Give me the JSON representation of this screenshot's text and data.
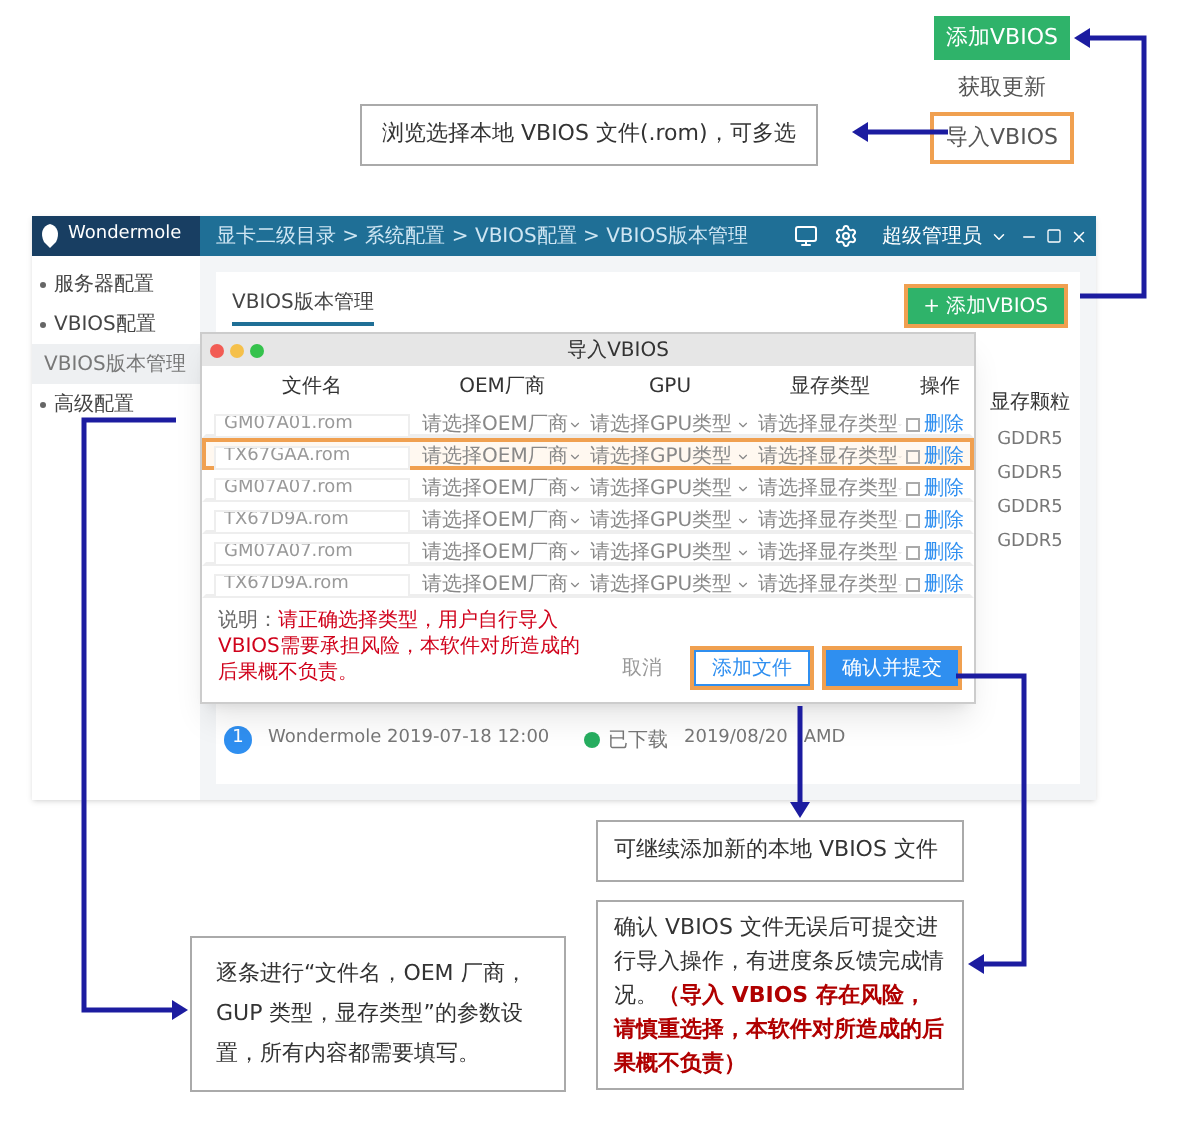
{
  "menu": {
    "items": [
      {
        "label": "添加VBIOS",
        "kind": "primary",
        "highlighted": false
      },
      {
        "label": "获取更新",
        "kind": "plain",
        "highlighted": false
      },
      {
        "label": "导入VBIOS",
        "kind": "plain",
        "highlighted": true
      }
    ]
  },
  "callouts": {
    "browse": "浏览选择本地 VBIOS 文件(.rom)，可多选",
    "add_more": "可继续添加新的本地 VBIOS 文件",
    "confirm": {
      "text": "确认 VBIOS 文件无误后可提交进行导入操作，有进度条反馈完成情况。",
      "warning": "（导入 VBIOS 存在风险，请慎重选择，本软件对所造成的后果概不负责）"
    },
    "fields": "逐条进行“文件名，OEM 厂商，GUP 类型，显存类型”的参数设置，所有内容都需要填写。"
  },
  "app": {
    "logo": "Wondermole",
    "breadcrumb": "显卡二级目录 > 系统配置 > VBIOS配置 > VBIOS版本管理",
    "user": "超级管理员",
    "sidebar": {
      "items": [
        {
          "label": "服务器配置",
          "selected": false
        },
        {
          "label": "VBIOS配置",
          "selected": false,
          "children": [
            {
              "label": "VBIOS版本管理",
              "selected": true
            }
          ]
        },
        {
          "label": "高级配置",
          "selected": false
        }
      ]
    },
    "tab": "VBIOS版本管理",
    "add_button": {
      "label": "+ 添加VBIOS",
      "highlighted": true
    },
    "side_column": {
      "header": "显存颗粒",
      "cells": [
        "GDDR5",
        "GDDR5",
        "GDDR5",
        "GDDR5"
      ]
    },
    "row": {
      "index": "1",
      "name": "Wondermole 2019-07-18 12:00",
      "status": "已下载",
      "date": "2019/08/20",
      "vendor": "AMD"
    }
  },
  "dialog": {
    "title": "导入VBIOS",
    "columns": [
      "文件名",
      "OEM厂商",
      "GPU",
      "显存类型",
      "操作"
    ],
    "rows": [
      {
        "file": "GM07A01.rom",
        "oem": "请选择OEM厂商",
        "gpu": "请选择GPU类型",
        "memory": "请选择显存类型",
        "action": "删除",
        "highlighted": false
      },
      {
        "file": "TX67GAA.rom",
        "oem": "请选择OEM厂商",
        "gpu": "请选择GPU类型",
        "memory": "请选择显存类型",
        "action": "删除",
        "highlighted": true
      },
      {
        "file": "GM07A07.rom",
        "oem": "请选择OEM厂商",
        "gpu": "请选择GPU类型",
        "memory": "请选择显存类型",
        "action": "删除",
        "highlighted": false
      },
      {
        "file": "TX67D9A.rom",
        "oem": "请选择OEM厂商",
        "gpu": "请选择GPU类型",
        "memory": "请选择显存类型",
        "action": "删除",
        "highlighted": false
      },
      {
        "file": "GM07A07.rom",
        "oem": "请选择OEM厂商",
        "gpu": "请选择GPU类型",
        "memory": "请选择显存类型",
        "action": "删除",
        "highlighted": false
      },
      {
        "file": "TX67D9A.rom",
        "oem": "请选择OEM厂商",
        "gpu": "请选择GPU类型",
        "memory": "请选择显存类型",
        "action": "删除",
        "highlighted": false
      }
    ],
    "note": {
      "label": "说明：",
      "text": "请正确选择类型，用户自行导入VBIOS需要承担风险，本软件对所造成的后果概不负责。"
    },
    "buttons": [
      {
        "label": "取消",
        "kind": "plain",
        "highlighted": false
      },
      {
        "label": "添加文件",
        "kind": "outline",
        "highlighted": true
      },
      {
        "label": "确认并提交",
        "kind": "primary",
        "highlighted": true
      }
    ]
  }
}
